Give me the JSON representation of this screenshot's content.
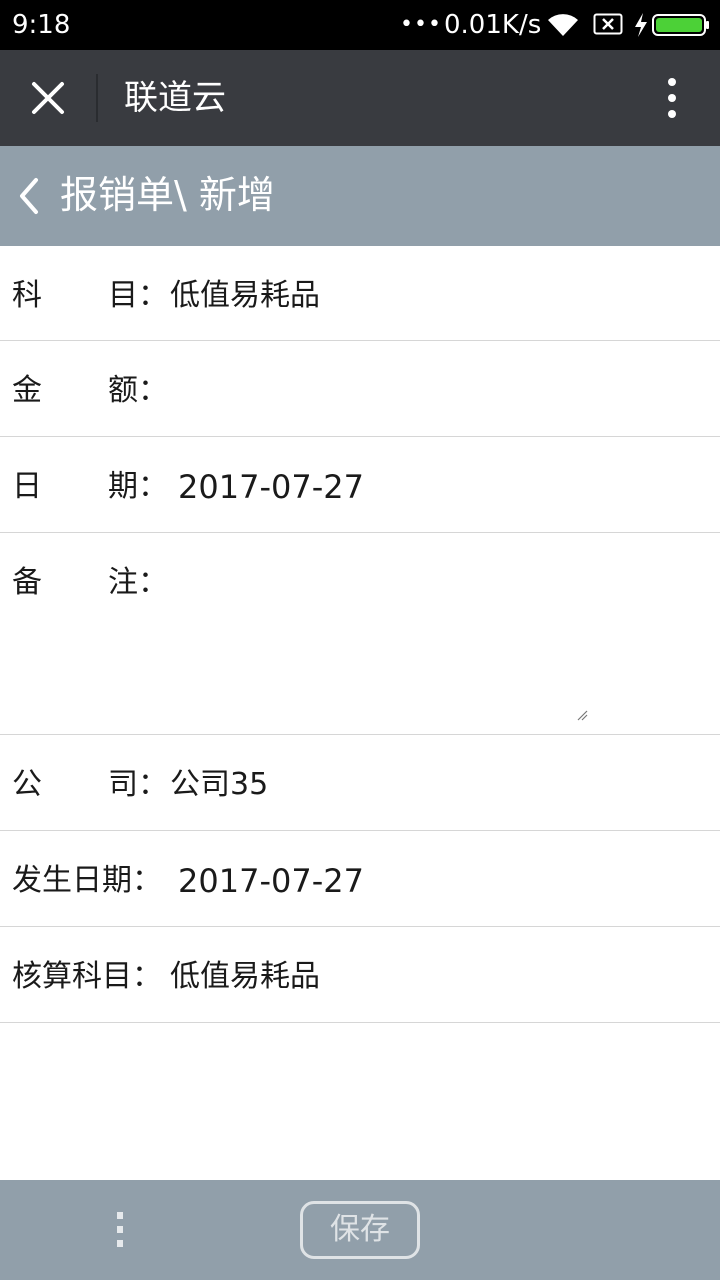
{
  "status_bar": {
    "time": "9:18",
    "dots": "•••",
    "net_speed": "0.01K/s",
    "battery_color": "#4cd137"
  },
  "app_bar": {
    "title": "联道云",
    "close_icon": "close-icon",
    "more_icon": "more-vertical-icon"
  },
  "page_header": {
    "back_icon": "chevron-left-icon",
    "title": "报销单\\ 新增"
  },
  "form": {
    "subject": {
      "label_a": "科",
      "label_b": "目：",
      "value": "低值易耗品"
    },
    "amount": {
      "label_a": "金",
      "label_b": "额：",
      "value": ""
    },
    "date": {
      "label_a": "日",
      "label_b": "期：",
      "value": "2017-07-27"
    },
    "remark": {
      "label_a": "备",
      "label_b": "注：",
      "value": ""
    },
    "company": {
      "label_a": "公",
      "label_b": "司：",
      "value": "公司35"
    },
    "occur_date": {
      "label": "发生日期：",
      "value": "2017-07-27"
    },
    "account": {
      "label": "核算科目：",
      "value": "低值易耗品"
    }
  },
  "bottom_bar": {
    "menu_icon": "more-vertical-icon",
    "save_label": "保存"
  },
  "colors": {
    "app_bar_bg": "#393b40",
    "header_bg": "#919faa",
    "divider": "#d6d6d6"
  }
}
